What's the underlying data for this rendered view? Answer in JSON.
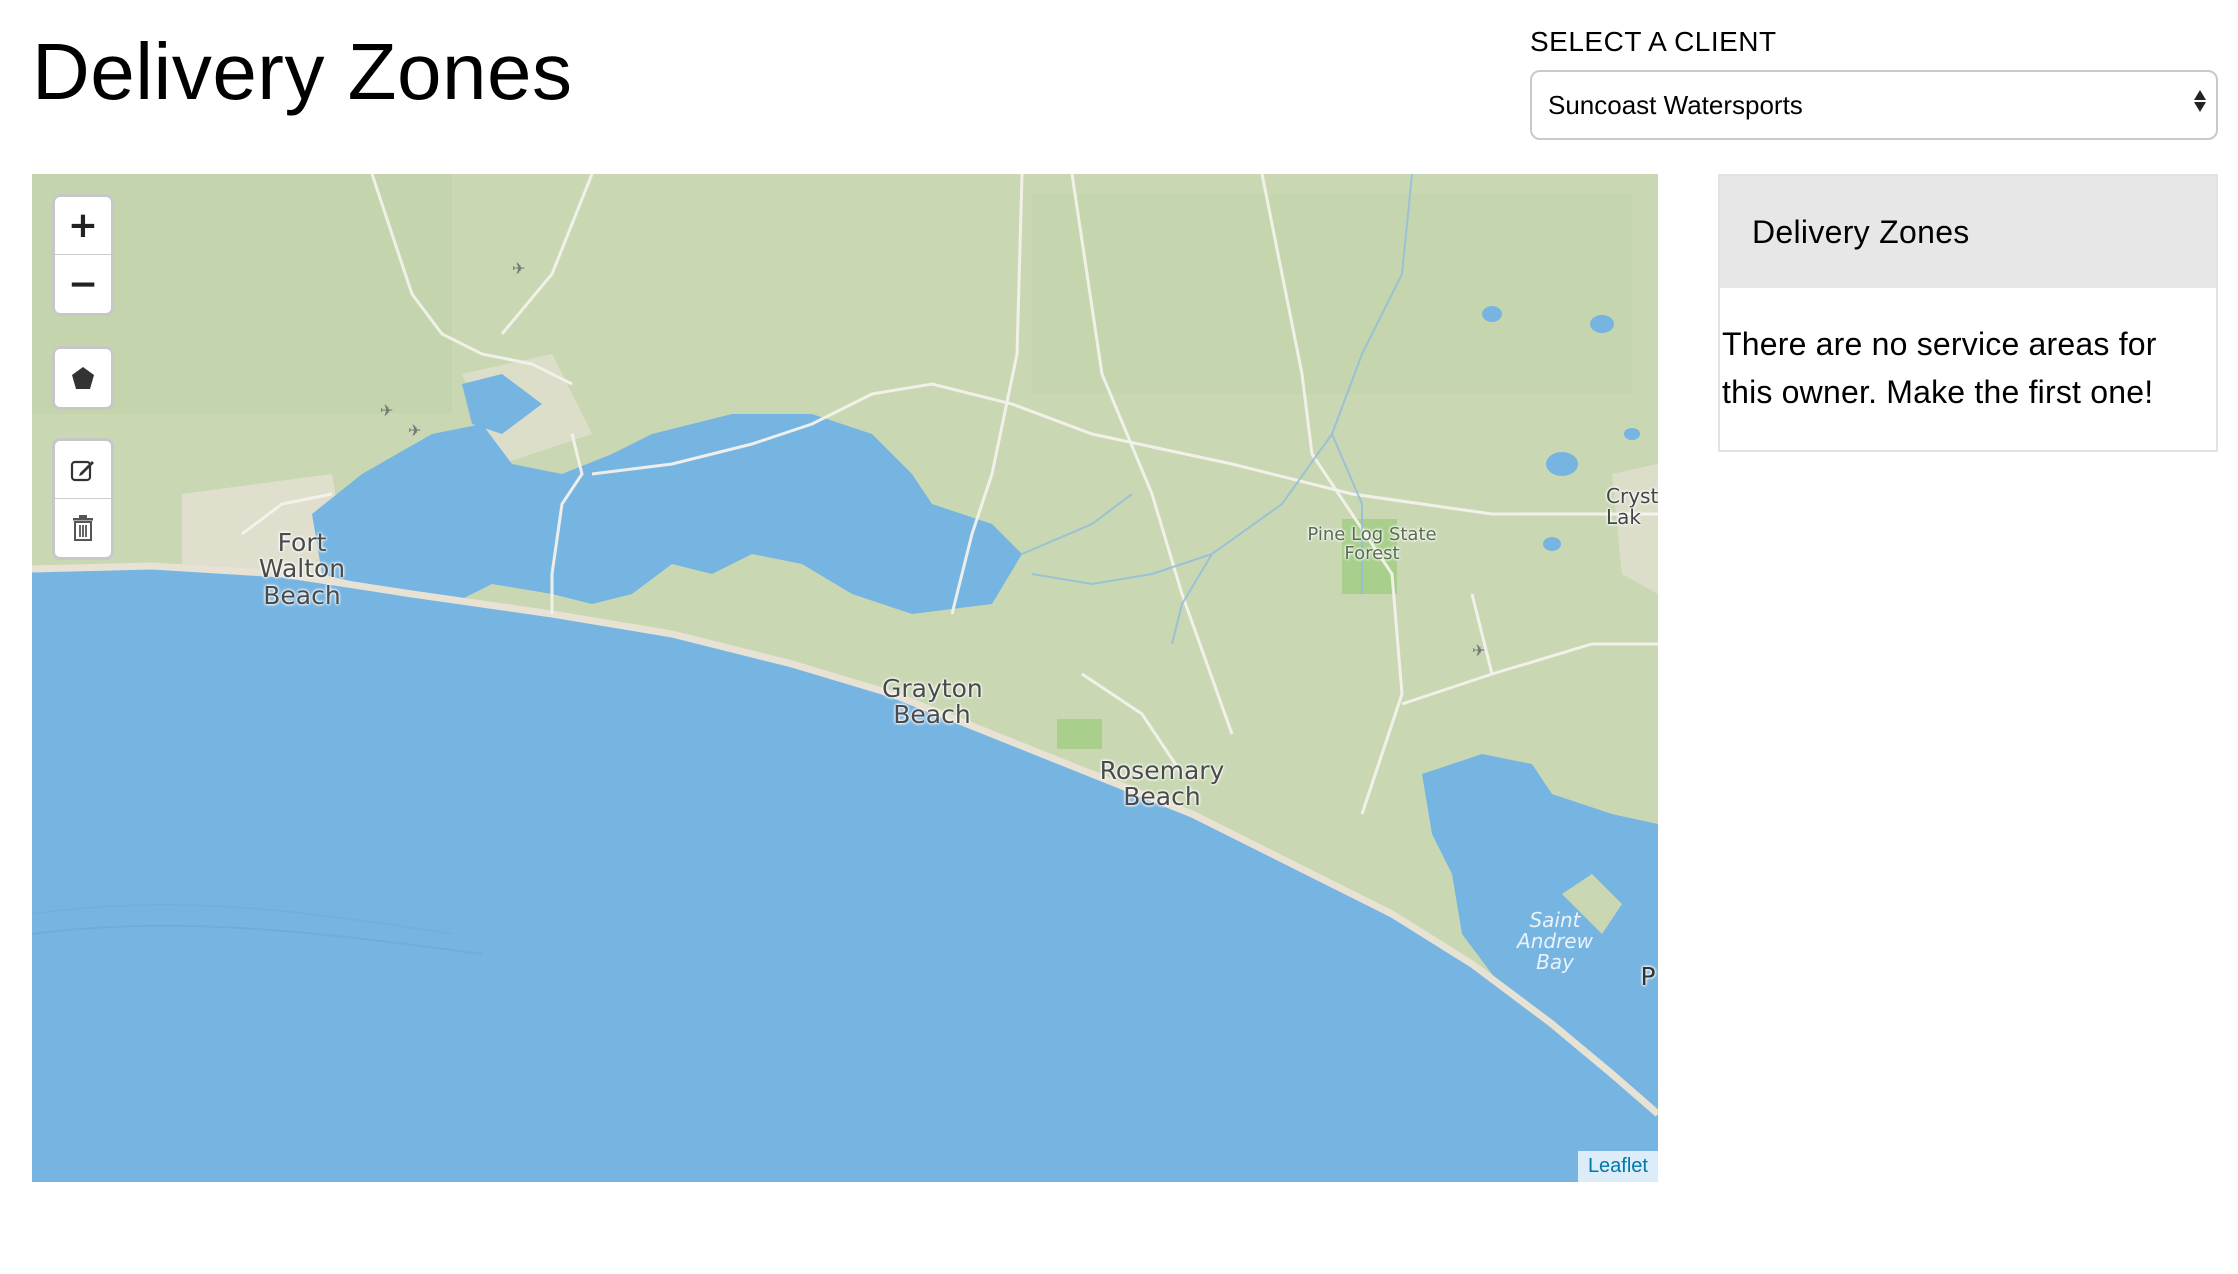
{
  "page": {
    "title": "Delivery Zones"
  },
  "client_select": {
    "label": "SELECT A CLIENT",
    "selected": "Suncoast Watersports"
  },
  "map": {
    "controls": {
      "zoom_in": "+",
      "zoom_out": "−",
      "draw_polygon_icon": "polygon-icon",
      "edit_icon": "edit-icon",
      "delete_icon": "trash-icon"
    },
    "labels": {
      "fort_walton": "Fort Walton Beach",
      "grayton": "Grayton Beach",
      "rosemary": "Rosemary Beach",
      "pine_log": "Pine Log State Forest",
      "crystal_lake": "Cryst Lak",
      "saint_andrew": "Saint Andrew Bay",
      "edge_p": "P"
    },
    "attribution": "Leaflet",
    "colors": {
      "water": "#76b5e2",
      "land": "#c9d8b3",
      "urban": "#e6e1d4",
      "park": "#a9cf8d"
    }
  },
  "zones_panel": {
    "title": "Delivery Zones",
    "empty_message": "There are no service areas for this owner. Make the first one!"
  }
}
